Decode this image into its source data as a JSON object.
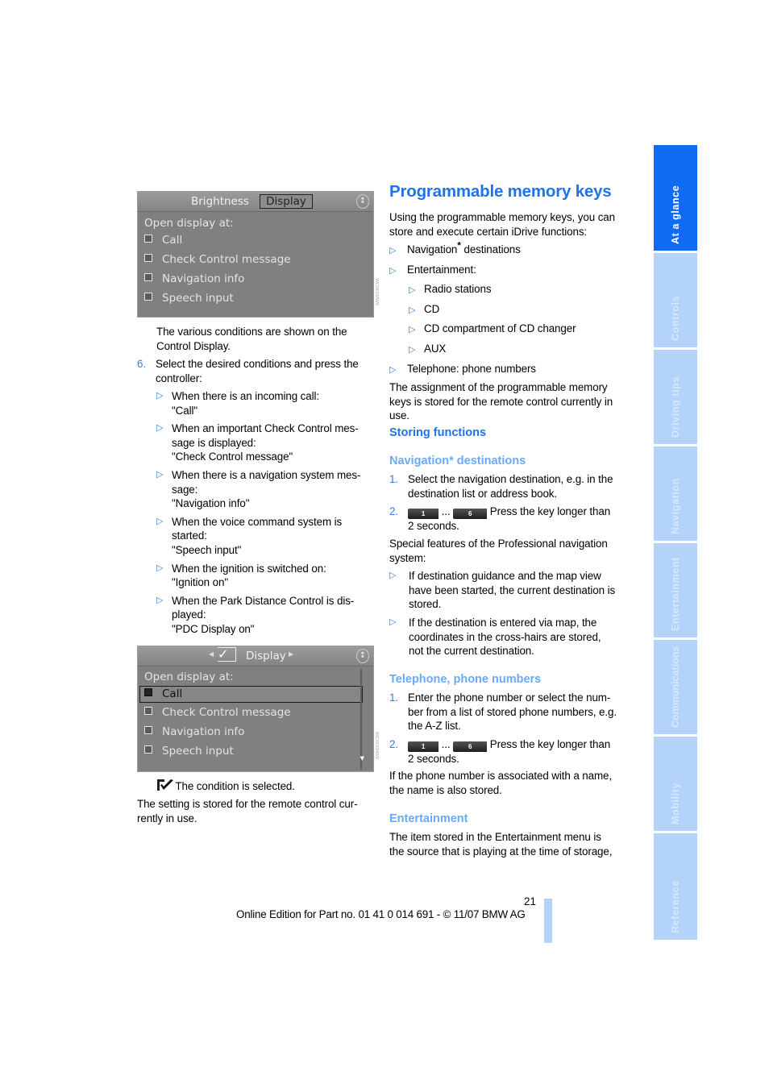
{
  "left_column": {
    "screen1": {
      "tabs": [
        "Brightness",
        "Display"
      ],
      "selected_tab": "Display",
      "heading": "Open display at:",
      "options": [
        "Call",
        "Check Control message",
        "Navigation info",
        "Speech input"
      ],
      "side_code": "W8M0338CMA"
    },
    "para1": "The various conditions are shown on the Control Display.",
    "step6": {
      "num": "6.",
      "text": "Select the desired conditions and press the controller:",
      "bullets": [
        {
          "lines": [
            "When there is an incoming call:",
            "\"Call\""
          ]
        },
        {
          "lines": [
            "When an important Check Control mes-",
            "sage is displayed:",
            "\"Check Control message\""
          ]
        },
        {
          "lines": [
            "When there is a navigation system mes-",
            "sage:",
            "\"Navigation info\""
          ]
        },
        {
          "lines": [
            "When the voice command system is",
            "started:",
            "\"Speech input\""
          ]
        },
        {
          "lines": [
            "When the ignition is switched on:",
            "\"Ignition on\""
          ]
        },
        {
          "lines": [
            "When the Park Distance Control is dis-",
            "played:",
            "\"PDC Display on\""
          ]
        }
      ]
    },
    "screen2": {
      "title": "Display",
      "heading": "Open display at:",
      "options": [
        "Call",
        "Check Control message",
        "Navigation info",
        "Speech input"
      ],
      "selected_option": "Call",
      "side_code": "W8M0339CMA"
    },
    "legend_text": "The condition is selected.",
    "para2": "The setting is stored for the remote control cur-rently in use.",
    "para2_lines": [
      "The setting is stored for the remote control cur-",
      "rently in use."
    ]
  },
  "right_column": {
    "title": "Programmable memory keys",
    "intro_lines": [
      "Using the programmable memory keys, you can",
      "store and execute certain iDrive functions:"
    ],
    "bullets": [
      {
        "label": "Navigation",
        "star": "*",
        "suffix": " destinations"
      },
      {
        "label": "Entertainment:"
      }
    ],
    "sub_bullets": [
      "Radio stations",
      "CD",
      "CD compartment of CD changer",
      "AUX"
    ],
    "bullet_phone": "Telephone: phone numbers",
    "assignment_lines": [
      "The assignment of the programmable memory",
      "keys is stored for the remote control currently in",
      "use."
    ],
    "storing_heading": "Storing functions",
    "nav_heading": "Navigation* destinations",
    "nav_steps": [
      {
        "num": "1.",
        "lines": [
          "Select the navigation destination, e.g. in the",
          "destination list or address book."
        ]
      },
      {
        "num": "2.",
        "key_first": "1",
        "ellipsis": "...",
        "key_last": "6",
        "after": "Press the key longer than",
        "line2": "2 seconds."
      }
    ],
    "special_lines": [
      "Special features of the Professional navigation",
      "system:"
    ],
    "special_bullets": [
      {
        "lines": [
          "If destination guidance and the map view",
          "have been started, the current destination is",
          "stored."
        ]
      },
      {
        "lines": [
          "If the destination is entered via map, the",
          "coordinates in the cross-hairs are stored,",
          "not the current destination."
        ]
      }
    ],
    "phone_heading": "Telephone, phone numbers",
    "phone_steps": [
      {
        "num": "1.",
        "lines": [
          "Enter the phone number or select the num-",
          "ber from a list of stored phone numbers, e.g.",
          "the A-Z list."
        ]
      },
      {
        "num": "2.",
        "key_first": "1",
        "ellipsis": "...",
        "key_last": "6",
        "after": "Press the key longer than",
        "line2": "2 seconds."
      }
    ],
    "phone_note_lines": [
      "If the phone number is associated with a name,",
      "the name is also stored."
    ],
    "ent_heading": "Entertainment",
    "ent_lines": [
      "The item stored in the Entertainment menu is",
      "the source that is playing at the time of storage,"
    ]
  },
  "sidebar": {
    "tabs": [
      {
        "label": "At a glance",
        "active": true
      },
      {
        "label": "Controls",
        "active": false
      },
      {
        "label": "Driving tips",
        "active": false
      },
      {
        "label": "Navigation",
        "active": false
      },
      {
        "label": "Entertainment",
        "active": false
      },
      {
        "label": "Communications",
        "active": false
      },
      {
        "label": "Mobility",
        "active": false
      },
      {
        "label": "Reference",
        "active": false
      }
    ]
  },
  "footer": {
    "page_number": "21",
    "edition": "Online Edition for Part no. 01 41 0 014 691 - © 11/07 BMW AG"
  },
  "colors": {
    "accent_blue": "#2f7fe0",
    "subheading_blue": "#6aaaf5",
    "tab_active": "#0f6cf2",
    "tab_inactive": "#b3d3fb"
  }
}
